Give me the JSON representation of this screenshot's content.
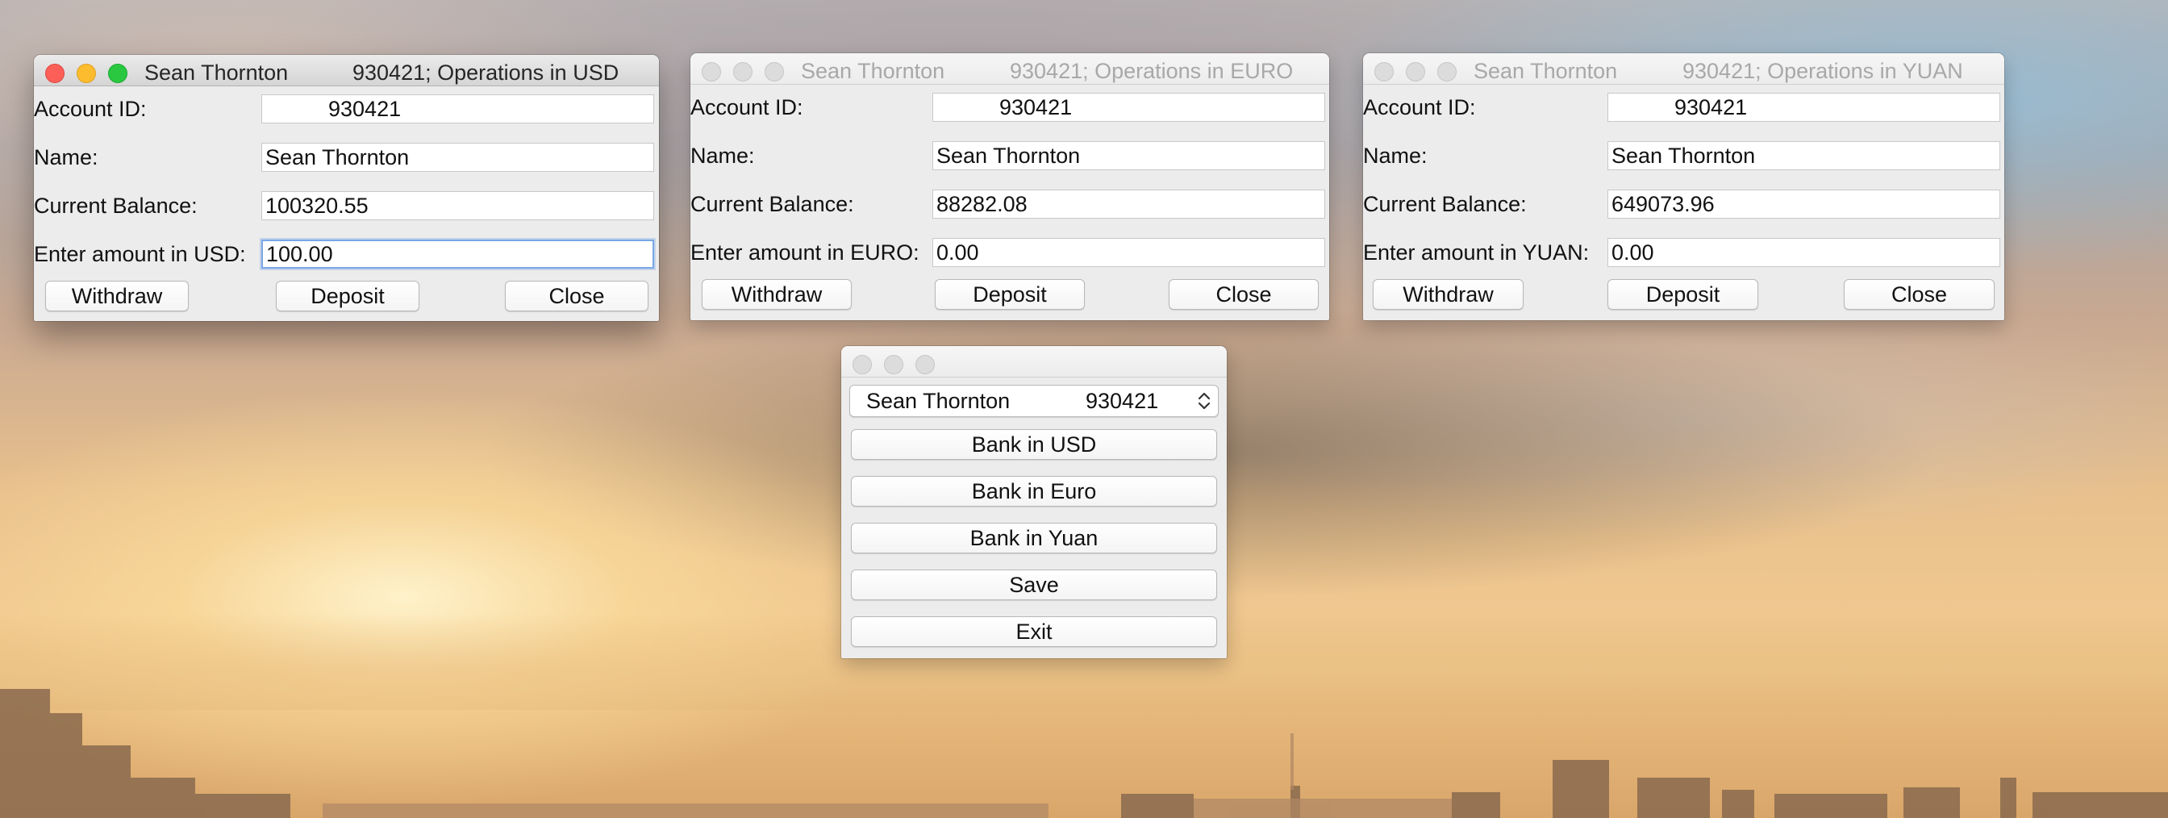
{
  "account": {
    "name": "Sean Thornton",
    "id": "930421"
  },
  "windows": {
    "usd": {
      "title_name": "Sean Thornton",
      "title_ops": "930421; Operations in USD",
      "labels": {
        "account_id": "Account ID:",
        "name": "Name:",
        "balance": "Current Balance:",
        "amount": "Enter amount in USD:"
      },
      "values": {
        "account_id": "930421",
        "name": "Sean Thornton",
        "balance": "100320.55",
        "amount": "100.00"
      },
      "buttons": {
        "withdraw": "Withdraw",
        "deposit": "Deposit",
        "close": "Close"
      }
    },
    "euro": {
      "title_name": "Sean Thornton",
      "title_ops": "930421; Operations in EURO",
      "labels": {
        "account_id": "Account ID:",
        "name": "Name:",
        "balance": "Current Balance:",
        "amount": "Enter amount in EURO:"
      },
      "values": {
        "account_id": "930421",
        "name": "Sean Thornton",
        "balance": "88282.08",
        "amount": "0.00"
      },
      "buttons": {
        "withdraw": "Withdraw",
        "deposit": "Deposit",
        "close": "Close"
      }
    },
    "yuan": {
      "title_name": "Sean Thornton",
      "title_ops": "930421; Operations in YUAN",
      "labels": {
        "account_id": "Account ID:",
        "name": "Name:",
        "balance": "Current Balance:",
        "amount": "Enter amount in YUAN:"
      },
      "values": {
        "account_id": "930421",
        "name": "Sean Thornton",
        "balance": "649073.96",
        "amount": "0.00"
      },
      "buttons": {
        "withdraw": "Withdraw",
        "deposit": "Deposit",
        "close": "Close"
      }
    },
    "main": {
      "selector": {
        "name": "Sean Thornton",
        "id": "930421"
      },
      "buttons": {
        "bank_usd": "Bank in USD",
        "bank_euro": "Bank in Euro",
        "bank_yuan": "Bank in Yuan",
        "save": "Save",
        "exit": "Exit"
      }
    }
  },
  "colors": {
    "close_light": "#fc5f58",
    "minimize_light": "#fdbc2e",
    "zoom_light": "#29c840",
    "focus_ring": "#7aa7e6",
    "window_bg": "#ececec"
  }
}
